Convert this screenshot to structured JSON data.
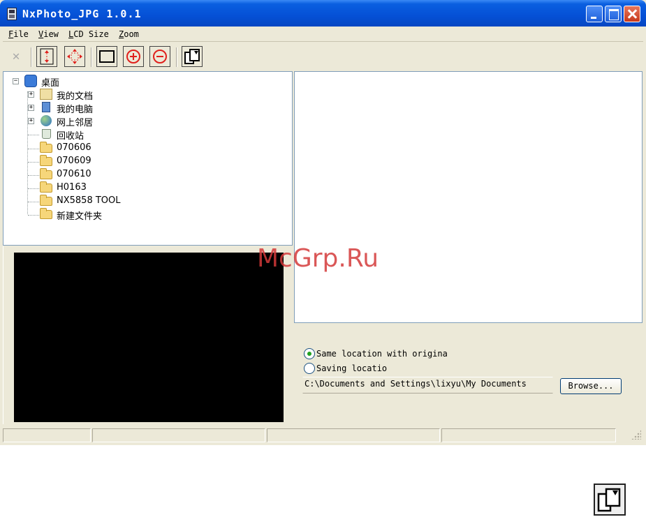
{
  "window": {
    "title": "NxPhoto_JPG 1.0.1"
  },
  "menu": {
    "file": "File",
    "view": "View",
    "lcd_size": "LCD Size",
    "zoom": "Zoom"
  },
  "toolbar": {
    "items": [
      "close-icon",
      "fit-height-icon",
      "fit-all-icon",
      "full-frame-icon",
      "zoom-in-icon",
      "zoom-out-icon",
      "rotate-copy-icon"
    ]
  },
  "tree": {
    "root": "桌面",
    "items": [
      {
        "label": "我的文档",
        "icon": "my-documents-icon",
        "expandable": true
      },
      {
        "label": "我的电脑",
        "icon": "my-computer-icon",
        "expandable": true
      },
      {
        "label": "网上邻居",
        "icon": "network-icon",
        "expandable": true
      },
      {
        "label": "回收站",
        "icon": "recycle-bin-icon",
        "expandable": false
      },
      {
        "label": "070606",
        "icon": "folder-icon",
        "expandable": false
      },
      {
        "label": "070609",
        "icon": "folder-icon",
        "expandable": false
      },
      {
        "label": "070610",
        "icon": "folder-icon",
        "expandable": false
      },
      {
        "label": "H0163",
        "icon": "folder-icon",
        "expandable": false
      },
      {
        "label": "NX5858 TOOL",
        "icon": "folder-icon",
        "expandable": false
      },
      {
        "label": "新建文件夹",
        "icon": "folder-icon",
        "expandable": false
      }
    ]
  },
  "save": {
    "same_location_label": "Same location with origina",
    "same_location_checked": true,
    "saving_location_label": "Saving locatio",
    "saving_location_checked": false,
    "path": "C:\\Documents and Settings\\lixyu\\My Documents",
    "browse_label": "Browse..."
  },
  "watermark": "McGrp.Ru",
  "colors": {
    "titlebar": "#0550d6",
    "window_bg": "#ece9d8",
    "watermark": "#d43a3a"
  }
}
